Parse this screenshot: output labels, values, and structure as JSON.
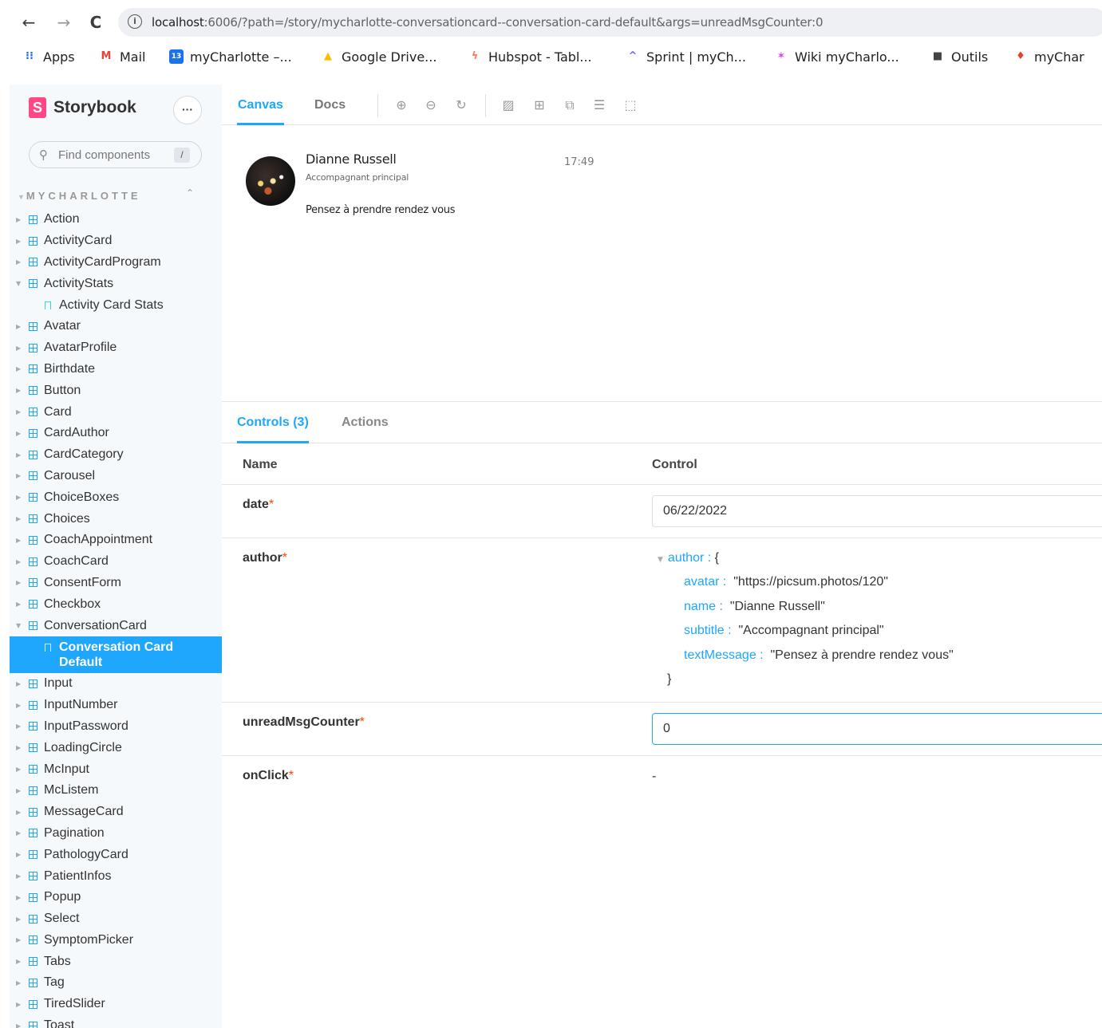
{
  "browser": {
    "nav": {
      "back": "←",
      "forward": "→",
      "reload": "C"
    },
    "url_host": "localhost",
    "url_rest": ":6006/?path=/story/mycharlotte-conversationcard--conversation-card-default&args=unreadMsgCounter:0",
    "bookmarks": [
      {
        "label": "Apps",
        "icon": "apps-grid-icon",
        "color": "#1a73e8"
      },
      {
        "label": "Mail",
        "icon": "gmail-icon",
        "color": "#ea4335"
      },
      {
        "label": "myCharlotte –...",
        "icon": "calendar-icon",
        "color": "#1a73e8"
      },
      {
        "label": "Google Drive...",
        "icon": "google-drive-icon",
        "color": "#fbbc04"
      },
      {
        "label": "Hubspot - Tabl...",
        "icon": "hubspot-icon",
        "color": "#ff7a59"
      },
      {
        "label": "Sprint | myCh...",
        "icon": "clickup-icon",
        "color": "#7b68ee"
      },
      {
        "label": "Wiki myCharlo...",
        "icon": "wiki-star-icon",
        "color": "#e040fb"
      },
      {
        "label": "Outils",
        "icon": "folder-icon",
        "color": "#444444"
      },
      {
        "label": "myChar",
        "icon": "gitlab-icon",
        "color": "#e24329"
      }
    ]
  },
  "sidebar": {
    "brand": "Storybook",
    "menu_label": "···",
    "search_placeholder": "Find components",
    "search_shortcut": "/",
    "group_title": "MYCHARLOTTE",
    "items": [
      {
        "label": "Action",
        "type": "component",
        "expanded": false
      },
      {
        "label": "ActivityCard",
        "type": "component",
        "expanded": false
      },
      {
        "label": "ActivityCardProgram",
        "type": "component",
        "expanded": false
      },
      {
        "label": "ActivityStats",
        "type": "component",
        "expanded": true
      },
      {
        "label": "Activity Card Stats",
        "type": "story",
        "selected": false
      },
      {
        "label": "Avatar",
        "type": "component",
        "expanded": false
      },
      {
        "label": "AvatarProfile",
        "type": "component",
        "expanded": false
      },
      {
        "label": "Birthdate",
        "type": "component",
        "expanded": false
      },
      {
        "label": "Button",
        "type": "component",
        "expanded": false
      },
      {
        "label": "Card",
        "type": "component",
        "expanded": false
      },
      {
        "label": "CardAuthor",
        "type": "component",
        "expanded": false
      },
      {
        "label": "CardCategory",
        "type": "component",
        "expanded": false
      },
      {
        "label": "Carousel",
        "type": "component",
        "expanded": false
      },
      {
        "label": "ChoiceBoxes",
        "type": "component",
        "expanded": false
      },
      {
        "label": "Choices",
        "type": "component",
        "expanded": false
      },
      {
        "label": "CoachAppointment",
        "type": "component",
        "expanded": false
      },
      {
        "label": "CoachCard",
        "type": "component",
        "expanded": false
      },
      {
        "label": "ConsentForm",
        "type": "component",
        "expanded": false
      },
      {
        "label": "Checkbox",
        "type": "component",
        "expanded": false
      },
      {
        "label": "ConversationCard",
        "type": "component",
        "expanded": true
      },
      {
        "label": "Conversation Card Default",
        "type": "story",
        "selected": true
      },
      {
        "label": "Input",
        "type": "component",
        "expanded": false
      },
      {
        "label": "InputNumber",
        "type": "component",
        "expanded": false
      },
      {
        "label": "InputPassword",
        "type": "component",
        "expanded": false
      },
      {
        "label": "LoadingCircle",
        "type": "component",
        "expanded": false
      },
      {
        "label": "McInput",
        "type": "component",
        "expanded": false
      },
      {
        "label": "McListem",
        "type": "component",
        "expanded": false
      },
      {
        "label": "MessageCard",
        "type": "component",
        "expanded": false
      },
      {
        "label": "Pagination",
        "type": "component",
        "expanded": false
      },
      {
        "label": "PathologyCard",
        "type": "component",
        "expanded": false
      },
      {
        "label": "PatientInfos",
        "type": "component",
        "expanded": false
      },
      {
        "label": "Popup",
        "type": "component",
        "expanded": false
      },
      {
        "label": "Select",
        "type": "component",
        "expanded": false
      },
      {
        "label": "SymptomPicker",
        "type": "component",
        "expanded": false
      },
      {
        "label": "Tabs",
        "type": "component",
        "expanded": false
      },
      {
        "label": "Tag",
        "type": "component",
        "expanded": false
      },
      {
        "label": "TiredSlider",
        "type": "component",
        "expanded": false
      },
      {
        "label": "Toast",
        "type": "component",
        "expanded": false
      }
    ]
  },
  "toolbar": {
    "tabs": [
      "Canvas",
      "Docs"
    ],
    "active_tab": "Canvas",
    "tools": [
      "zoom-in-icon",
      "zoom-out-icon",
      "zoom-reset-icon",
      "background-icon",
      "grid-icon",
      "viewport-icon",
      "measure-icon",
      "outline-icon"
    ]
  },
  "preview": {
    "name": "Dianne Russell",
    "subtitle": "Accompagnant principal",
    "time": "17:49",
    "message": "Pensez à prendre rendez vous"
  },
  "addons": {
    "tabs": [
      "Controls (3)",
      "Actions"
    ],
    "active_tab": "Controls (3)",
    "header": {
      "name": "Name",
      "control": "Control"
    },
    "controls": {
      "date": {
        "name": "date",
        "required": "*",
        "value": "06/22/2022"
      },
      "author": {
        "name": "author",
        "required": "*",
        "object_key": "author :",
        "open_brace": "{",
        "close_brace": "}",
        "fields": [
          {
            "key": "avatar :",
            "value": "\"https://picsum.photos/120\""
          },
          {
            "key": "name :",
            "value": "\"Dianne Russell\""
          },
          {
            "key": "subtitle :",
            "value": "\"Accompagnant principal\""
          },
          {
            "key": "textMessage :",
            "value": "\"Pensez à prendre rendez vous\""
          }
        ]
      },
      "unreadMsgCounter": {
        "name": "unreadMsgCounter",
        "required": "*",
        "value": "0"
      },
      "onClick": {
        "name": "onClick",
        "required": "*",
        "value": "-"
      }
    }
  },
  "colors": {
    "accent": "#1ea7fd",
    "brand": "#ff4785",
    "required": "#ff4400",
    "sidebar_bg": "#f6f9fc"
  }
}
